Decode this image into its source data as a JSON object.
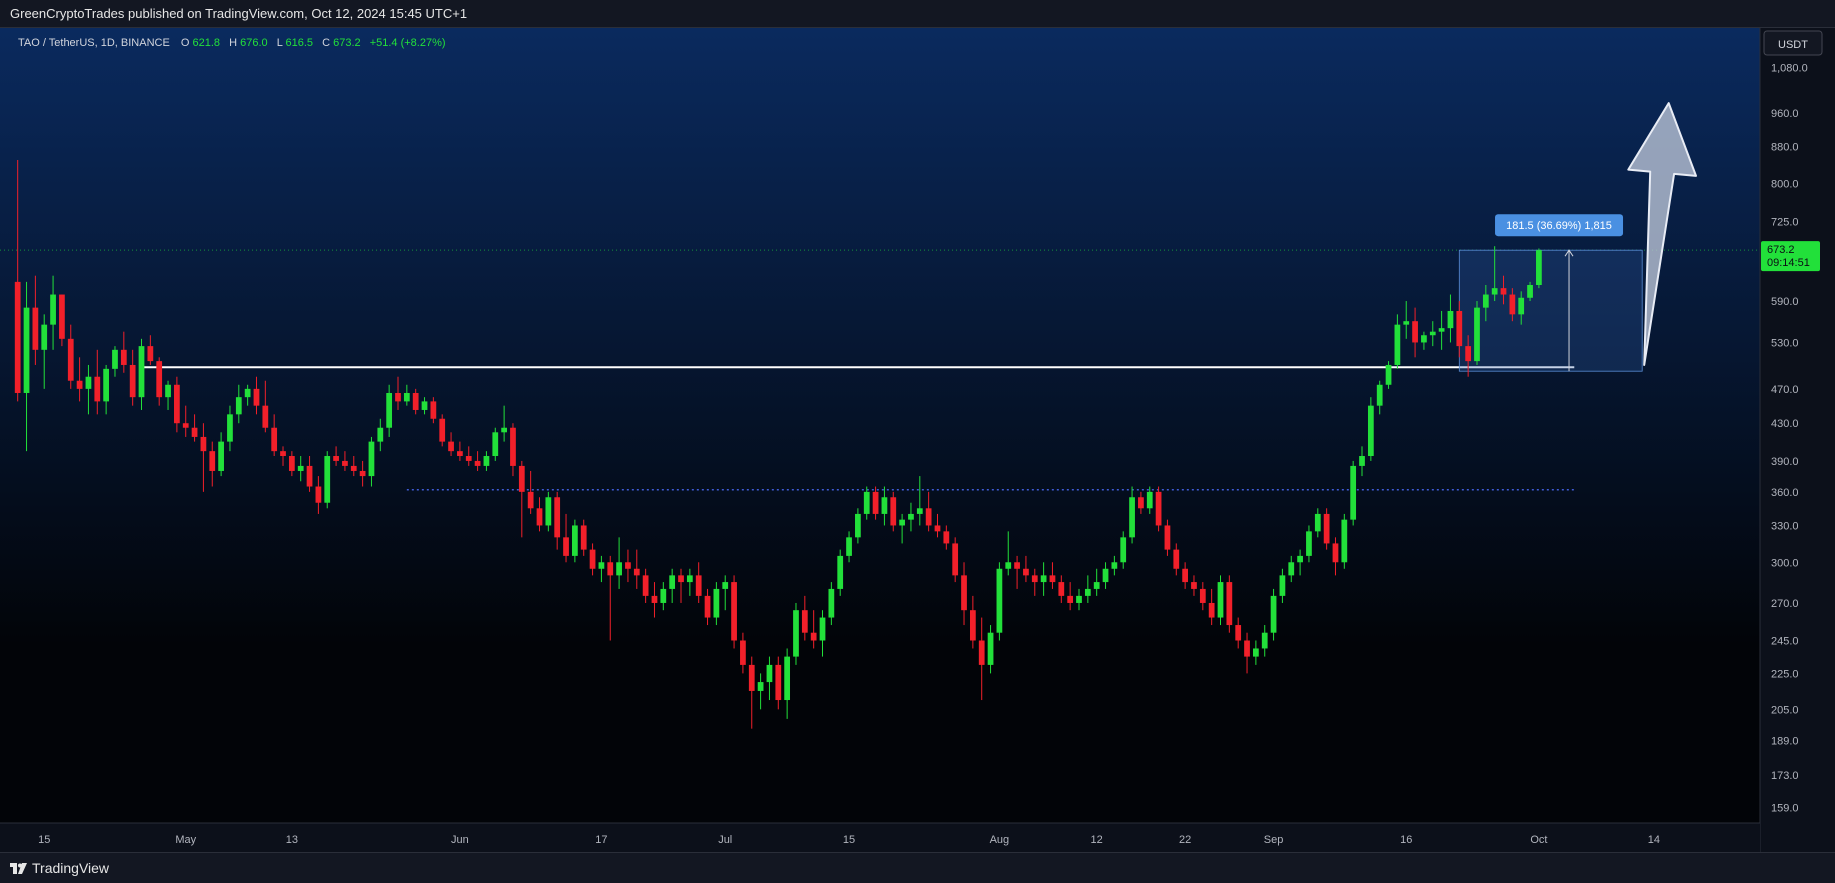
{
  "header": {
    "published": "GreenCryptoTrades published on TradingView.com, Oct 12, 2024 15:45 UTC+1"
  },
  "footer": {
    "brand": "TradingView"
  },
  "colors": {
    "up": "#22e03a",
    "down": "#f2202a",
    "bg_top": "#0a2a5e",
    "bg_bottom": "#020408",
    "axis_bg": "#0c101a",
    "support_line": "#ffffff",
    "dotted_line": "#3f5bd6",
    "measure_label_bg": "#4a90e2",
    "price_tag_bg": "#22e03a",
    "arrow_fill": "#b9c3d6"
  },
  "chart_data": {
    "type": "candlestick",
    "legend": {
      "symbol": "TAO / TetherUS, 1D, BINANCE",
      "open_label": "O",
      "open": "621.8",
      "high_label": "H",
      "high": "676.0",
      "low_label": "L",
      "low": "616.5",
      "close_label": "C",
      "close": "673.2",
      "change": "+51.4 (+8.27%)"
    },
    "currency": "USDT",
    "y_scale": "log",
    "y_ticks": [
      "1,080.0",
      "960.0",
      "880.0",
      "800.0",
      "725.0",
      "590.0",
      "530.0",
      "470.0",
      "430.0",
      "390.0",
      "360.0",
      "330.0",
      "300.0",
      "270.0",
      "245.0",
      "225.0",
      "205.0",
      "189.0",
      "173.0",
      "159.0"
    ],
    "x_ticks": [
      {
        "label": "15",
        "date": "2024-04-15"
      },
      {
        "label": "May",
        "date": "2024-05-01"
      },
      {
        "label": "13",
        "date": "2024-05-13"
      },
      {
        "label": "Jun",
        "date": "2024-06-01"
      },
      {
        "label": "17",
        "date": "2024-06-17"
      },
      {
        "label": "Jul",
        "date": "2024-07-01"
      },
      {
        "label": "15",
        "date": "2024-07-15"
      },
      {
        "label": "Aug",
        "date": "2024-08-01"
      },
      {
        "label": "12",
        "date": "2024-08-12"
      },
      {
        "label": "22",
        "date": "2024-08-22"
      },
      {
        "label": "Sep",
        "date": "2024-09-01"
      },
      {
        "label": "16",
        "date": "2024-09-16"
      },
      {
        "label": "Oct",
        "date": "2024-10-01"
      },
      {
        "label": "14",
        "date": "2024-10-14"
      }
    ],
    "x_range": [
      "2024-04-10",
      "2024-10-26"
    ],
    "first_date": "2024-04-12",
    "last_price": {
      "value": "673.2",
      "countdown": "09:14:51"
    },
    "support_level": 497,
    "dotted_level": 362,
    "measure": {
      "label": "181.5 (36.69%) 1,815",
      "from": 492,
      "to": 673,
      "start": "2024-09-22",
      "end": "2024-10-12"
    },
    "arrow": {
      "from": {
        "date": "2024-10-12",
        "price": 500
      },
      "to": {
        "date": "2024-10-15",
        "price": 985
      }
    },
    "candles": [
      [
        620,
        850,
        455,
        465
      ],
      [
        465,
        620,
        400,
        580
      ],
      [
        580,
        630,
        500,
        520
      ],
      [
        520,
        570,
        470,
        555
      ],
      [
        555,
        630,
        520,
        600
      ],
      [
        600,
        600,
        525,
        535
      ],
      [
        535,
        555,
        470,
        480
      ],
      [
        480,
        510,
        455,
        470
      ],
      [
        470,
        500,
        440,
        485
      ],
      [
        485,
        520,
        440,
        455
      ],
      [
        455,
        500,
        440,
        495
      ],
      [
        495,
        525,
        485,
        520
      ],
      [
        520,
        545,
        490,
        500
      ],
      [
        500,
        520,
        450,
        460
      ],
      [
        460,
        535,
        445,
        525
      ],
      [
        525,
        540,
        500,
        505
      ],
      [
        505,
        510,
        450,
        460
      ],
      [
        460,
        480,
        445,
        475
      ],
      [
        475,
        485,
        420,
        430
      ],
      [
        430,
        450,
        415,
        425
      ],
      [
        425,
        440,
        410,
        415
      ],
      [
        415,
        430,
        360,
        400
      ],
      [
        400,
        410,
        365,
        380
      ],
      [
        380,
        420,
        375,
        410
      ],
      [
        410,
        450,
        400,
        440
      ],
      [
        440,
        475,
        430,
        460
      ],
      [
        460,
        475,
        450,
        470
      ],
      [
        470,
        485,
        440,
        450
      ],
      [
        450,
        480,
        420,
        425
      ],
      [
        425,
        440,
        395,
        400
      ],
      [
        400,
        405,
        385,
        395
      ],
      [
        395,
        400,
        375,
        380
      ],
      [
        380,
        395,
        370,
        385
      ],
      [
        385,
        395,
        360,
        365
      ],
      [
        365,
        375,
        340,
        350
      ],
      [
        350,
        400,
        345,
        395
      ],
      [
        395,
        405,
        385,
        390
      ],
      [
        390,
        400,
        380,
        385
      ],
      [
        385,
        395,
        375,
        380
      ],
      [
        380,
        390,
        365,
        375
      ],
      [
        375,
        415,
        365,
        410
      ],
      [
        410,
        435,
        400,
        425
      ],
      [
        425,
        475,
        415,
        465
      ],
      [
        465,
        485,
        445,
        455
      ],
      [
        455,
        475,
        450,
        465
      ],
      [
        465,
        470,
        440,
        445
      ],
      [
        445,
        460,
        440,
        455
      ],
      [
        455,
        460,
        430,
        435
      ],
      [
        435,
        440,
        405,
        410
      ],
      [
        410,
        420,
        395,
        400
      ],
      [
        400,
        410,
        390,
        395
      ],
      [
        395,
        405,
        385,
        390
      ],
      [
        390,
        400,
        380,
        385
      ],
      [
        385,
        400,
        380,
        395
      ],
      [
        395,
        425,
        390,
        420
      ],
      [
        420,
        450,
        410,
        425
      ],
      [
        425,
        430,
        375,
        385
      ],
      [
        385,
        390,
        320,
        360
      ],
      [
        360,
        380,
        340,
        345
      ],
      [
        345,
        355,
        325,
        330
      ],
      [
        330,
        360,
        325,
        355
      ],
      [
        355,
        360,
        310,
        320
      ],
      [
        320,
        340,
        300,
        305
      ],
      [
        305,
        335,
        300,
        330
      ],
      [
        330,
        335,
        305,
        310
      ],
      [
        310,
        315,
        290,
        295
      ],
      [
        295,
        305,
        285,
        300
      ],
      [
        300,
        305,
        245,
        290
      ],
      [
        290,
        320,
        280,
        300
      ],
      [
        300,
        310,
        285,
        295
      ],
      [
        295,
        310,
        280,
        290
      ],
      [
        290,
        295,
        270,
        275
      ],
      [
        275,
        285,
        260,
        270
      ],
      [
        270,
        285,
        265,
        280
      ],
      [
        280,
        295,
        270,
        290
      ],
      [
        290,
        295,
        270,
        285
      ],
      [
        285,
        295,
        275,
        290
      ],
      [
        290,
        300,
        270,
        275
      ],
      [
        275,
        280,
        255,
        260
      ],
      [
        260,
        285,
        255,
        280
      ],
      [
        280,
        290,
        265,
        285
      ],
      [
        285,
        290,
        240,
        245
      ],
      [
        245,
        250,
        225,
        230
      ],
      [
        230,
        235,
        195,
        215
      ],
      [
        215,
        225,
        205,
        220
      ],
      [
        220,
        235,
        210,
        230
      ],
      [
        230,
        235,
        205,
        210
      ],
      [
        210,
        240,
        200,
        235
      ],
      [
        235,
        270,
        230,
        265
      ],
      [
        265,
        275,
        245,
        250
      ],
      [
        250,
        265,
        240,
        245
      ],
      [
        245,
        265,
        235,
        260
      ],
      [
        260,
        285,
        255,
        280
      ],
      [
        280,
        310,
        275,
        305
      ],
      [
        305,
        325,
        300,
        320
      ],
      [
        320,
        345,
        315,
        340
      ],
      [
        340,
        365,
        335,
        360
      ],
      [
        360,
        365,
        335,
        340
      ],
      [
        340,
        365,
        330,
        355
      ],
      [
        355,
        360,
        325,
        330
      ],
      [
        330,
        340,
        315,
        335
      ],
      [
        335,
        350,
        325,
        340
      ],
      [
        340,
        375,
        330,
        345
      ],
      [
        345,
        360,
        325,
        330
      ],
      [
        330,
        340,
        320,
        325
      ],
      [
        325,
        330,
        310,
        315
      ],
      [
        315,
        320,
        285,
        290
      ],
      [
        290,
        300,
        255,
        265
      ],
      [
        265,
        275,
        240,
        245
      ],
      [
        245,
        260,
        210,
        230
      ],
      [
        230,
        255,
        225,
        250
      ],
      [
        250,
        300,
        245,
        295
      ],
      [
        295,
        325,
        290,
        300
      ],
      [
        300,
        305,
        280,
        295
      ],
      [
        295,
        305,
        285,
        290
      ],
      [
        290,
        295,
        275,
        285
      ],
      [
        285,
        300,
        275,
        290
      ],
      [
        290,
        300,
        280,
        285
      ],
      [
        285,
        290,
        270,
        275
      ],
      [
        275,
        285,
        265,
        270
      ],
      [
        270,
        280,
        265,
        275
      ],
      [
        275,
        290,
        270,
        280
      ],
      [
        280,
        295,
        275,
        285
      ],
      [
        285,
        300,
        280,
        295
      ],
      [
        295,
        305,
        290,
        300
      ],
      [
        300,
        325,
        295,
        320
      ],
      [
        320,
        365,
        315,
        355
      ],
      [
        355,
        360,
        340,
        345
      ],
      [
        345,
        365,
        340,
        360
      ],
      [
        360,
        365,
        325,
        330
      ],
      [
        330,
        335,
        305,
        310
      ],
      [
        310,
        315,
        290,
        295
      ],
      [
        295,
        300,
        280,
        285
      ],
      [
        285,
        290,
        275,
        280
      ],
      [
        280,
        285,
        265,
        270
      ],
      [
        270,
        280,
        255,
        260
      ],
      [
        260,
        290,
        255,
        285
      ],
      [
        285,
        290,
        250,
        255
      ],
      [
        255,
        260,
        240,
        245
      ],
      [
        245,
        250,
        225,
        235
      ],
      [
        235,
        245,
        230,
        240
      ],
      [
        240,
        255,
        235,
        250
      ],
      [
        250,
        280,
        245,
        275
      ],
      [
        275,
        295,
        270,
        290
      ],
      [
        290,
        305,
        285,
        300
      ],
      [
        300,
        310,
        290,
        305
      ],
      [
        305,
        330,
        300,
        325
      ],
      [
        325,
        345,
        320,
        340
      ],
      [
        340,
        345,
        310,
        315
      ],
      [
        315,
        320,
        290,
        300
      ],
      [
        300,
        340,
        295,
        335
      ],
      [
        335,
        390,
        330,
        385
      ],
      [
        385,
        405,
        375,
        395
      ],
      [
        395,
        460,
        390,
        450
      ],
      [
        450,
        480,
        440,
        475
      ],
      [
        475,
        505,
        470,
        500
      ],
      [
        500,
        570,
        495,
        555
      ],
      [
        555,
        590,
        535,
        560
      ],
      [
        560,
        580,
        510,
        530
      ],
      [
        530,
        545,
        520,
        540
      ],
      [
        540,
        560,
        525,
        545
      ],
      [
        545,
        575,
        520,
        550
      ],
      [
        550,
        600,
        530,
        575
      ],
      [
        575,
        590,
        510,
        525
      ],
      [
        525,
        540,
        485,
        505
      ],
      [
        505,
        590,
        500,
        580
      ],
      [
        580,
        615,
        560,
        600
      ],
      [
        600,
        680,
        590,
        610
      ],
      [
        610,
        630,
        585,
        600
      ],
      [
        600,
        610,
        560,
        570
      ],
      [
        570,
        605,
        555,
        595
      ],
      [
        595,
        620,
        590,
        615
      ],
      [
        615,
        676,
        610,
        673
      ]
    ]
  }
}
